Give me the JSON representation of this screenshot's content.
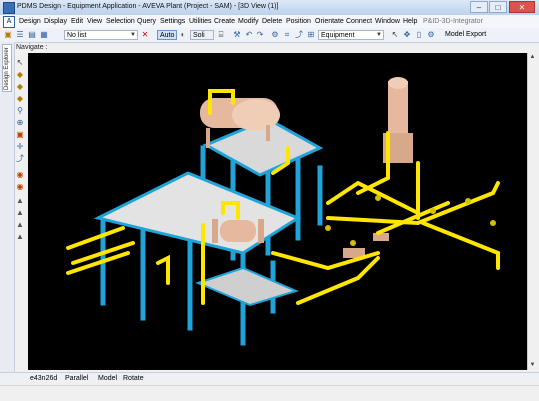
{
  "window": {
    "title": "PDMS Design - Equipment Application - AVEVA Plant (Project - SAM) - [3D View (1)]",
    "minimize_icon": "minimize-icon",
    "maximize_icon": "maximize-icon",
    "close_label": "✕"
  },
  "menubar": {
    "items": [
      "Design",
      "Display",
      "Edit",
      "View",
      "Selection",
      "Query",
      "Settings",
      "Utilities",
      "Create",
      "Modify",
      "Delete",
      "Position",
      "Orientate",
      "Connect",
      "Window",
      "Help"
    ],
    "integrator": "P&ID-3D-Integrator"
  },
  "toolbar": {
    "list_value": "No list",
    "auto_label": "Auto",
    "soli_value": "Soli",
    "equipment_value": "Equipment",
    "model_export_label": "Model Export"
  },
  "sidebar": {
    "tab_label": "Design Explorer"
  },
  "navigate": {
    "label": "Navigate :"
  },
  "status": {
    "items": [
      "e43n26d",
      "Parallel",
      "Model",
      "Rotate"
    ]
  },
  "colors": {
    "viewport_bg": "#000000",
    "steel": "#1fa3d9",
    "deck": "#d9d9d9",
    "pipe": "#ffe600",
    "equipment": "#e6b89e"
  }
}
